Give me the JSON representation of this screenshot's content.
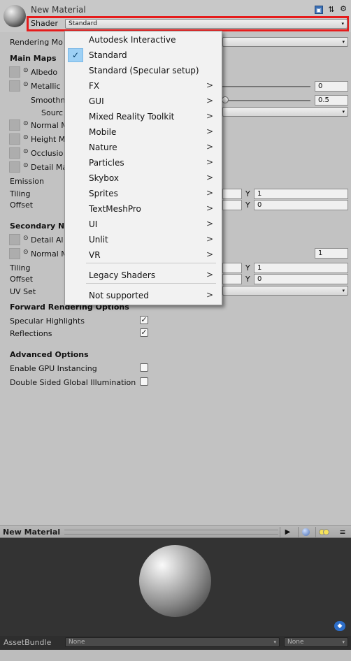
{
  "header": {
    "title": "New Material",
    "shader_label": "Shader",
    "shader_value": "Standard",
    "highlight_color": "#e51b1b"
  },
  "inspector": {
    "rendering_mode_label": "Rendering Mo",
    "main_maps_title": "Main Maps",
    "albedo_label": "Albedo",
    "metallic_label": "Metallic",
    "metallic_value": "0",
    "smoothness_label": "Smoothn",
    "smoothness_value": "0.5",
    "source_label": "Sourc",
    "normal_map_label": "Normal M",
    "height_map_label": "Height M",
    "occlusion_label": "Occlusio",
    "detail_mask_label": "Detail Ma",
    "emission_label": "Emission",
    "tiling_label": "Tiling",
    "tiling_y_label": "Y",
    "tiling_y_value": "1",
    "offset_label": "Offset",
    "offset_y_label": "Y",
    "offset_y_value": "0",
    "secondary_title": "Secondary N",
    "detail_albedo_label": "Detail Al",
    "sec_normal_label": "Normal M",
    "sec_normal_value": "1",
    "sec_tiling_label": "Tiling",
    "sec_tiling_y_label": "Y",
    "sec_tiling_y_value": "1",
    "sec_offset_label": "Offset",
    "sec_offset_y_label": "Y",
    "sec_offset_y_value": "0",
    "uv_set_label": "UV Set",
    "forward_title": "Forward Rendering Options",
    "specular_label": "Specular Highlights",
    "reflections_label": "Reflections",
    "advanced_title": "Advanced Options",
    "gpu_instancing_label": "Enable GPU Instancing",
    "double_sided_label": "Double Sided Global Illumination"
  },
  "shader_menu": {
    "items": [
      {
        "label": "Autodesk Interactive",
        "submenu": false,
        "checked": false
      },
      {
        "label": "Standard",
        "submenu": false,
        "checked": true
      },
      {
        "label": "Standard (Specular setup)",
        "submenu": false,
        "checked": false
      },
      {
        "label": "FX",
        "submenu": true,
        "checked": false
      },
      {
        "label": "GUI",
        "submenu": true,
        "checked": false
      },
      {
        "label": "Mixed Reality Toolkit",
        "submenu": true,
        "checked": false
      },
      {
        "label": "Mobile",
        "submenu": true,
        "checked": false
      },
      {
        "label": "Nature",
        "submenu": true,
        "checked": false
      },
      {
        "label": "Particles",
        "submenu": true,
        "checked": false
      },
      {
        "label": "Skybox",
        "submenu": true,
        "checked": false
      },
      {
        "label": "Sprites",
        "submenu": true,
        "checked": false
      },
      {
        "label": "TextMeshPro",
        "submenu": true,
        "checked": false
      },
      {
        "label": "UI",
        "submenu": true,
        "checked": false
      },
      {
        "label": "Unlit",
        "submenu": true,
        "checked": false
      },
      {
        "label": "VR",
        "submenu": true,
        "checked": false
      },
      {
        "label": "Legacy Shaders",
        "submenu": true,
        "checked": false
      },
      {
        "label": "Not supported",
        "submenu": true,
        "checked": false
      }
    ],
    "submenu_glyph": ">",
    "check_glyph": "✓"
  },
  "preview": {
    "title": "New Material",
    "assetbundle_label": "AssetBundle",
    "assetbundle_value": "None",
    "variant_value": "None"
  }
}
